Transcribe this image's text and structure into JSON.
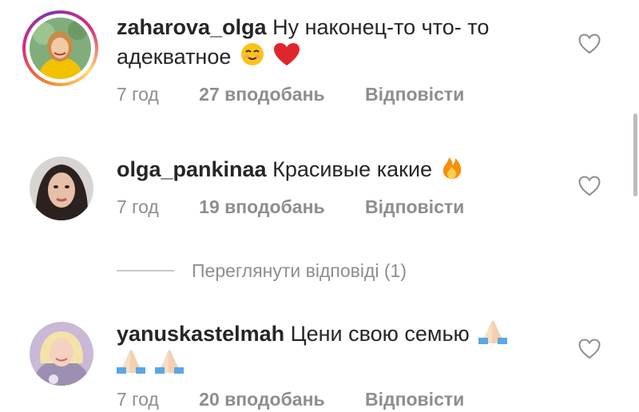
{
  "comments": [
    {
      "username": "zaharova_olga",
      "text_line1": "Ну наконец-то что- то",
      "text_line2": "адекватное",
      "time": "7 год",
      "likes": "27 вподобань",
      "reply": "Відповісти",
      "has_story": true,
      "emojis": [
        "smiling-face-icon",
        "red-heart-icon"
      ]
    },
    {
      "username": "olga_pankinaa",
      "text_line1": "Красивые какие",
      "time": "7 год",
      "likes": "19 вподобань",
      "reply": "Відповісти",
      "has_story": false,
      "emojis": [
        "fire-icon"
      ]
    },
    {
      "username": "yanuskastelmah",
      "text_line1": "Цени свою семью",
      "time": "7 год",
      "likes": "20 вподобань",
      "reply": "Відповісти",
      "has_story": false,
      "emojis": [
        "folded-hands-icon",
        "folded-hands-icon",
        "folded-hands-icon"
      ]
    }
  ],
  "view_replies": "Переглянути відповіді (1)",
  "colors": {
    "text": "#262626",
    "secondary": "#8e8e8e",
    "divider": "#c7c7c7"
  }
}
